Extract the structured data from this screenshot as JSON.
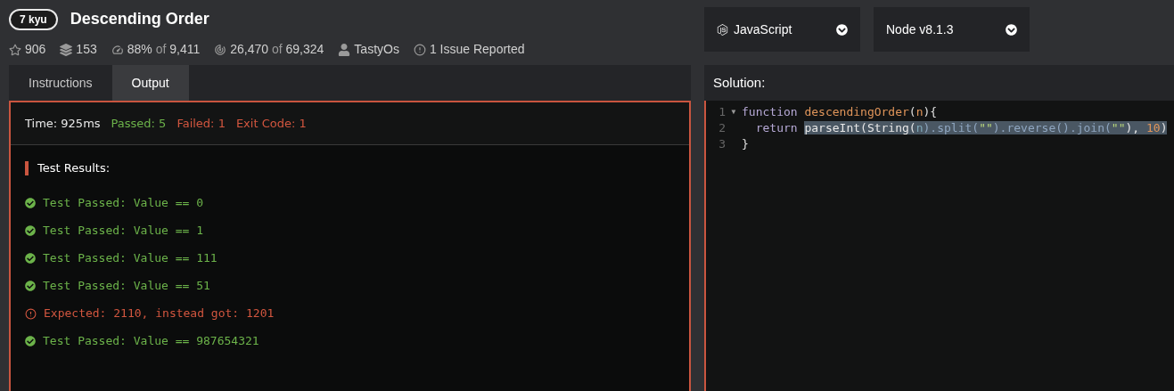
{
  "kata": {
    "rank": "7 kyu",
    "title": "Descending Order"
  },
  "stats": [
    {
      "kind": "stars",
      "value": "906"
    },
    {
      "kind": "collections",
      "value": "153"
    },
    {
      "kind": "satisfaction",
      "value": "88%",
      "of_label": "of",
      "total": "9,411"
    },
    {
      "kind": "completions",
      "value": "26,470",
      "of_label": "of",
      "total": "69,324"
    },
    {
      "kind": "author",
      "value": "TastyOs"
    },
    {
      "kind": "issues",
      "value": "1 Issue Reported"
    }
  ],
  "selectors": [
    {
      "kind": "language",
      "label": "JavaScript"
    },
    {
      "kind": "version",
      "label": "Node v8.1.3"
    }
  ],
  "tabs": [
    {
      "label": "Instructions",
      "selected": false
    },
    {
      "label": "Output",
      "selected": true
    }
  ],
  "summary": [
    {
      "kind": "neutral",
      "text": "Time: 925ms"
    },
    {
      "kind": "pass",
      "text": "Passed: 5"
    },
    {
      "kind": "fail",
      "text": "Failed: 1"
    },
    {
      "kind": "fail",
      "text": "Exit Code: 1"
    }
  ],
  "results_title": "Test Results:",
  "results": [
    {
      "kind": "pass",
      "text": "Test Passed: Value == 0"
    },
    {
      "kind": "pass",
      "text": "Test Passed: Value == 1"
    },
    {
      "kind": "pass",
      "text": "Test Passed: Value == 111"
    },
    {
      "kind": "pass",
      "text": "Test Passed: Value == 51"
    },
    {
      "kind": "fail",
      "text": "Expected: 2110, instead got: 1201"
    },
    {
      "kind": "pass",
      "text": "Test Passed: Value == 987654321"
    }
  ],
  "solution": {
    "title": "Solution:",
    "lines": [
      {
        "number": "1",
        "fold": "▼",
        "tokens": [
          {
            "kind": "keyword",
            "text": "function ",
            "selected": false
          },
          {
            "kind": "name",
            "text": "descendingOrder",
            "selected": false
          },
          {
            "kind": "punct",
            "text": "(",
            "selected": false
          },
          {
            "kind": "param",
            "text": "n",
            "selected": false
          },
          {
            "kind": "punct",
            "text": "){",
            "selected": false
          }
        ]
      },
      {
        "number": "2",
        "tokens": [
          {
            "kind": "keyword",
            "text": "  return ",
            "selected": false
          },
          {
            "kind": "plain",
            "text": "parseInt(String(",
            "selected": true
          },
          {
            "kind": "var",
            "text": "n",
            "selected": true
          },
          {
            "kind": "prop",
            "text": ").split(",
            "selected": true
          },
          {
            "kind": "string",
            "text": "\"\"",
            "selected": true
          },
          {
            "kind": "prop",
            "text": ").reverse().join(",
            "selected": true
          },
          {
            "kind": "string",
            "text": "\"\"",
            "selected": true
          },
          {
            "kind": "plain",
            "text": "), ",
            "selected": true
          },
          {
            "kind": "number",
            "text": "10",
            "selected": true
          },
          {
            "kind": "plain",
            "text": ")",
            "selected": true
          }
        ]
      },
      {
        "number": "3",
        "tokens": [
          {
            "kind": "punct",
            "text": "}",
            "selected": false
          }
        ]
      }
    ]
  }
}
